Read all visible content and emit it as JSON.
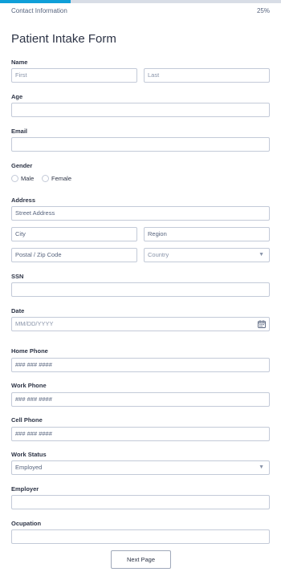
{
  "progress": {
    "section": "Contact Information",
    "percent_label": "25%",
    "percent": 25
  },
  "form": {
    "title": "Patient Intake Form"
  },
  "name": {
    "label": "Name",
    "first_placeholder": "First",
    "last_placeholder": "Last"
  },
  "age": {
    "label": "Age",
    "value": ""
  },
  "email": {
    "label": "Email",
    "value": ""
  },
  "gender": {
    "label": "Gender",
    "options": [
      "Male",
      "Female"
    ]
  },
  "address": {
    "label": "Address",
    "street_placeholder": "Street Address",
    "city_placeholder": "City",
    "region_placeholder": "Region",
    "zip_placeholder": "Postal / Zip Code",
    "country_placeholder": "Country"
  },
  "ssn": {
    "label": "SSN",
    "value": ""
  },
  "date": {
    "label": "Date",
    "placeholder": "MM/DD/YYYY"
  },
  "home_phone": {
    "label": "Home Phone",
    "placeholder": "### ### ####"
  },
  "work_phone": {
    "label": "Work Phone",
    "placeholder": "### ### ####"
  },
  "cell_phone": {
    "label": "Cell Phone",
    "placeholder": "### ### ####"
  },
  "work_status": {
    "label": "Work Status",
    "selected": "Employed"
  },
  "employer": {
    "label": "Employer",
    "value": ""
  },
  "occupation": {
    "label": "Ocupation",
    "value": ""
  },
  "buttons": {
    "next_label": "Next Page"
  },
  "colors": {
    "accent": "#0f9fd8",
    "border": "#c3cad8",
    "text": "#2c3345",
    "muted": "#8994a9"
  }
}
